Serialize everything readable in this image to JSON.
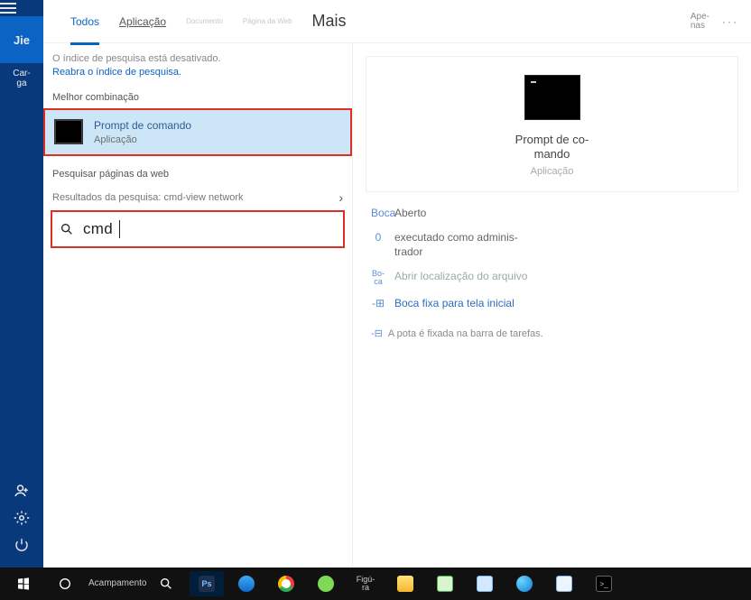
{
  "rail": {
    "user": "Jie",
    "load": "Car-\nga"
  },
  "filters": {
    "all": "Todos",
    "app": "Aplicação",
    "doc": "Documento",
    "doc_sub": "",
    "web": "Página da Web",
    "more": "Mais",
    "only": "Ape-\nnas",
    "ellipsis": "···"
  },
  "notice": {
    "line1": "O índice de pesquisa está desativado.",
    "link": "Reabra o índice de pesquisa."
  },
  "sections": {
    "best": "Melhor combinação",
    "web": "Pesquisar páginas da web"
  },
  "best_match": {
    "name": "Prompt de comando",
    "type": "Aplicação"
  },
  "web_result": {
    "label": "Resultados da pesquisa: cmd-view network",
    "chevron": "›"
  },
  "search": {
    "query": "cmd"
  },
  "preview": {
    "name": "Prompt de co-\nmando",
    "type": "Aplicação"
  },
  "actions": {
    "open_icon": "Boca",
    "open": "Aberto",
    "admin_icon": "0",
    "admin": "executado como adminis-\ntrador",
    "loc_icon": "Bo-\nca",
    "loc": "Abrir localização do arquivo",
    "pin_start_icon": "-⊞",
    "pin_start": "Boca fixa para tela inicial",
    "pinned_hint_icon": "-⊟",
    "pinned_hint": "A pota é fixada na barra de tarefas."
  },
  "taskbar": {
    "camp": "Acampamento",
    "fig": "Figú-\nra"
  }
}
